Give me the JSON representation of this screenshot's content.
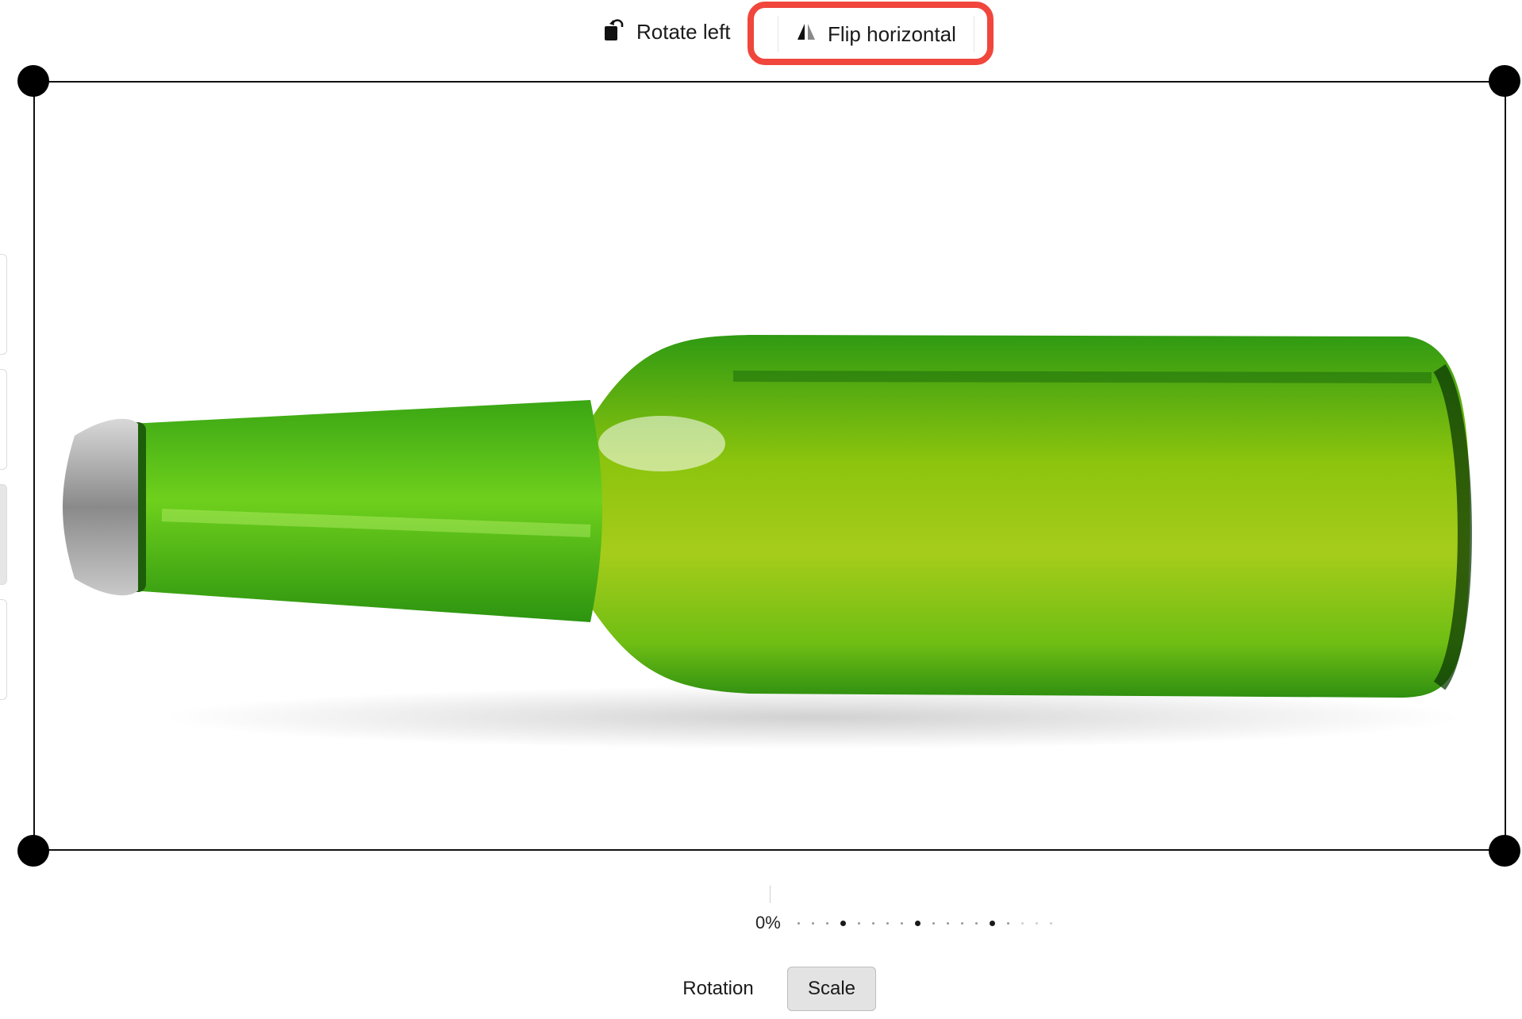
{
  "toolbar": {
    "rotate_left_label": "Rotate left",
    "rotate_left_icon": "rotate-left-icon",
    "flip_horizontal_label": "Flip horizontal",
    "flip_horizontal_icon": "flip-horizontal-icon",
    "highlight_color": "#f0463c"
  },
  "canvas": {
    "image_subject": "green glass bottle lying horizontally",
    "bottle_color": "#4fbf1a"
  },
  "slider": {
    "value_label": "0%",
    "value_percent": 0
  },
  "mode_tabs": [
    {
      "label": "Rotation",
      "active": false
    },
    {
      "label": "Scale",
      "active": true
    }
  ]
}
